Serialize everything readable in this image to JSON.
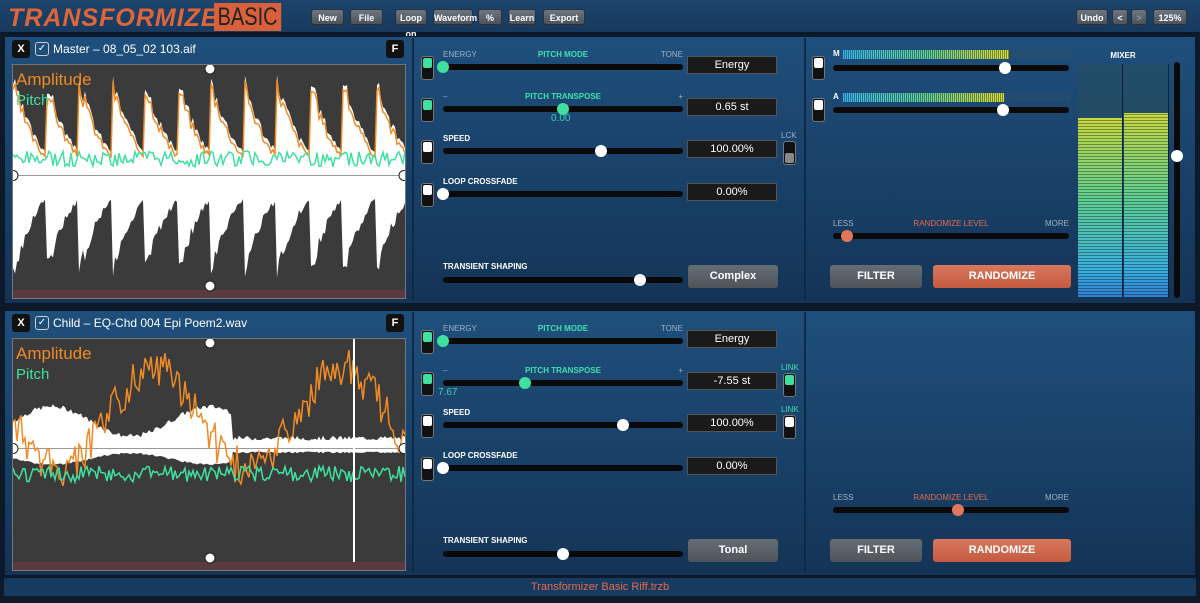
{
  "app": {
    "logo": "TRANSFORMIZER",
    "edition": "BASIC",
    "registered": "®"
  },
  "toolbar": {
    "buttons": [
      "New",
      "File",
      "Loop on",
      "Waveform",
      "%",
      "Learn",
      "Export"
    ],
    "undo": "Undo",
    "back": "<",
    "forward": ">",
    "zoom": "125%"
  },
  "tracks": [
    {
      "close": "X",
      "checked": true,
      "file": "Master – 08_05_02 103.aif",
      "f": "F",
      "amp_label": "Amplitude",
      "pitch_label": "Pitch",
      "pitch_mode": {
        "left": "ENERGY",
        "title": "PITCH MODE",
        "right": "TONE",
        "value": "Energy",
        "level": 0.0
      },
      "pitch_transpose": {
        "left": "–",
        "title": "PITCH TRANSPOSE",
        "right": "+",
        "value": "0.65 st",
        "readout": "0.00",
        "level": 0.5
      },
      "speed": {
        "title": "SPEED",
        "value": "100.00%",
        "level": 0.66,
        "lock_label": "LCK"
      },
      "loop_crossfade": {
        "title": "LOOP CROSSFADE",
        "value": "0.00%",
        "level": 0.0
      },
      "transient": {
        "title": "TRANSIENT SHAPING",
        "value": "Complex",
        "level": 0.82
      },
      "randomize": {
        "less": "LESS",
        "title": "RANDOMIZE LEVEL",
        "more": "MORE",
        "level": 0.06
      },
      "filter": "FILTER",
      "randomize_btn": "RANDOMIZE"
    },
    {
      "close": "X",
      "checked": true,
      "file": "Child – EQ-Chd 004 Epi Poem2.wav",
      "f": "F",
      "amp_label": "Amplitude",
      "pitch_label": "Pitch",
      "pitch_mode": {
        "left": "ENERGY",
        "title": "PITCH MODE",
        "right": "TONE",
        "value": "Energy",
        "level": 0.0
      },
      "pitch_transpose": {
        "left": "–",
        "title": "PITCH TRANSPOSE",
        "right": "+",
        "value": "-7.55 st",
        "readout": "7.67",
        "level": 0.34,
        "link_label": "LINK"
      },
      "speed": {
        "title": "SPEED",
        "value": "100.00%",
        "level": 0.75,
        "link_label": "LINK"
      },
      "loop_crossfade": {
        "title": "LOOP CROSSFADE",
        "value": "0.00%",
        "level": 0.0
      },
      "transient": {
        "title": "TRANSIENT SHAPING",
        "value": "Tonal",
        "level": 0.5
      },
      "randomize": {
        "less": "LESS",
        "title": "RANDOMIZE LEVEL",
        "more": "MORE",
        "level": 0.53
      },
      "filter": "FILTER",
      "randomize_btn": "RANDOMIZE"
    }
  ],
  "mix": {
    "m_label": "M",
    "a_label": "A",
    "m_level": 0.73,
    "a_level": 0.72,
    "m_meter": 0.73,
    "a_meter": 0.71,
    "mixer_label": "MIXER",
    "mixer_level": 0.4,
    "meter_left": 0.77,
    "meter_right": 0.79
  },
  "colors": {
    "amplitude": "#f08a24",
    "pitch": "#3fe0a0",
    "accent": "#e0653a"
  },
  "footer": "Transformizer Basic Riff.trzb"
}
